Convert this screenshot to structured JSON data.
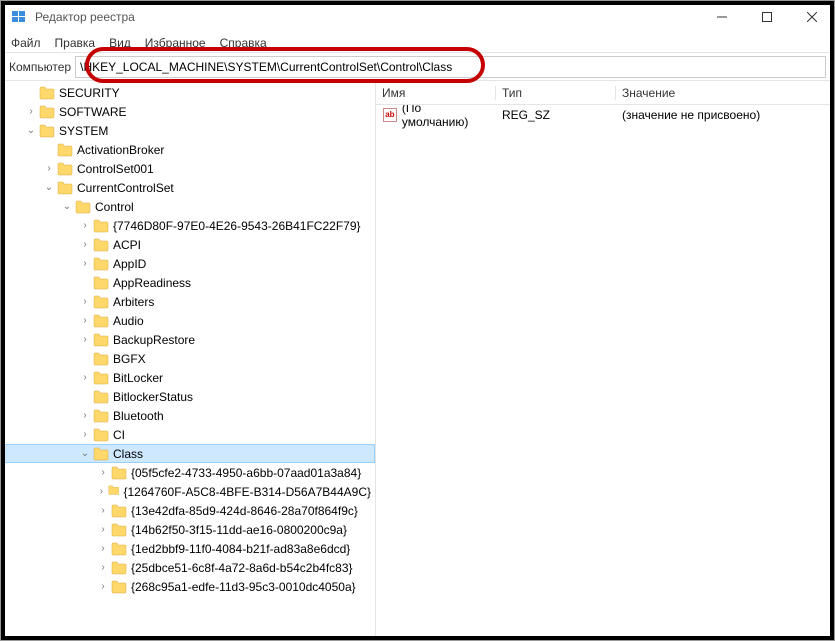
{
  "window": {
    "title": "Редактор реестра"
  },
  "menu": {
    "file": "Файл",
    "edit": "Правка",
    "view": "Вид",
    "favorites": "Избранное",
    "help": "Справка"
  },
  "address": {
    "label": "Компьютер",
    "path": "\\HKEY_LOCAL_MACHINE\\SYSTEM\\CurrentControlSet\\Control\\Class"
  },
  "tree": {
    "root_nodes": [
      {
        "label": "SECURITY",
        "indent": 1,
        "expander": "",
        "truncated": true
      },
      {
        "label": "SOFTWARE",
        "indent": 1,
        "expander": "›"
      },
      {
        "label": "SYSTEM",
        "indent": 1,
        "expander": "⌄"
      },
      {
        "label": "ActivationBroker",
        "indent": 2,
        "expander": " "
      },
      {
        "label": "ControlSet001",
        "indent": 2,
        "expander": "›"
      },
      {
        "label": "CurrentControlSet",
        "indent": 2,
        "expander": "⌄"
      },
      {
        "label": "Control",
        "indent": 3,
        "expander": "⌄"
      },
      {
        "label": "{7746D80F-97E0-4E26-9543-26B41FC22F79}",
        "indent": 4,
        "expander": "›"
      },
      {
        "label": "ACPI",
        "indent": 4,
        "expander": "›"
      },
      {
        "label": "AppID",
        "indent": 4,
        "expander": "›"
      },
      {
        "label": "AppReadiness",
        "indent": 4,
        "expander": " "
      },
      {
        "label": "Arbiters",
        "indent": 4,
        "expander": "›"
      },
      {
        "label": "Audio",
        "indent": 4,
        "expander": "›"
      },
      {
        "label": "BackupRestore",
        "indent": 4,
        "expander": "›"
      },
      {
        "label": "BGFX",
        "indent": 4,
        "expander": " "
      },
      {
        "label": "BitLocker",
        "indent": 4,
        "expander": "›"
      },
      {
        "label": "BitlockerStatus",
        "indent": 4,
        "expander": " "
      },
      {
        "label": "Bluetooth",
        "indent": 4,
        "expander": "›"
      },
      {
        "label": "CI",
        "indent": 4,
        "expander": "›"
      },
      {
        "label": "Class",
        "indent": 4,
        "expander": "⌄",
        "selected": true
      },
      {
        "label": "{05f5cfe2-4733-4950-a6bb-07aad01a3a84}",
        "indent": 5,
        "expander": "›"
      },
      {
        "label": "{1264760F-A5C8-4BFE-B314-D56A7B44A9C}",
        "indent": 5,
        "expander": "›"
      },
      {
        "label": "{13e42dfa-85d9-424d-8646-28a70f864f9c}",
        "indent": 5,
        "expander": "›"
      },
      {
        "label": "{14b62f50-3f15-11dd-ae16-0800200c9a}",
        "indent": 5,
        "expander": "›"
      },
      {
        "label": "{1ed2bbf9-11f0-4084-b21f-ad83a8e6dcd}",
        "indent": 5,
        "expander": "›"
      },
      {
        "label": "{25dbce51-6c8f-4a72-8a6d-b54c2b4fc83}",
        "indent": 5,
        "expander": "›"
      },
      {
        "label": "{268c95a1-edfe-11d3-95c3-0010dc4050a}",
        "indent": 5,
        "expander": "›"
      }
    ]
  },
  "values": {
    "headers": {
      "name": "Имя",
      "type": "Тип",
      "value": "Значение"
    },
    "rows": [
      {
        "name": "(По умолчанию)",
        "type": "REG_SZ",
        "value": "(значение не присвоено)"
      }
    ]
  }
}
